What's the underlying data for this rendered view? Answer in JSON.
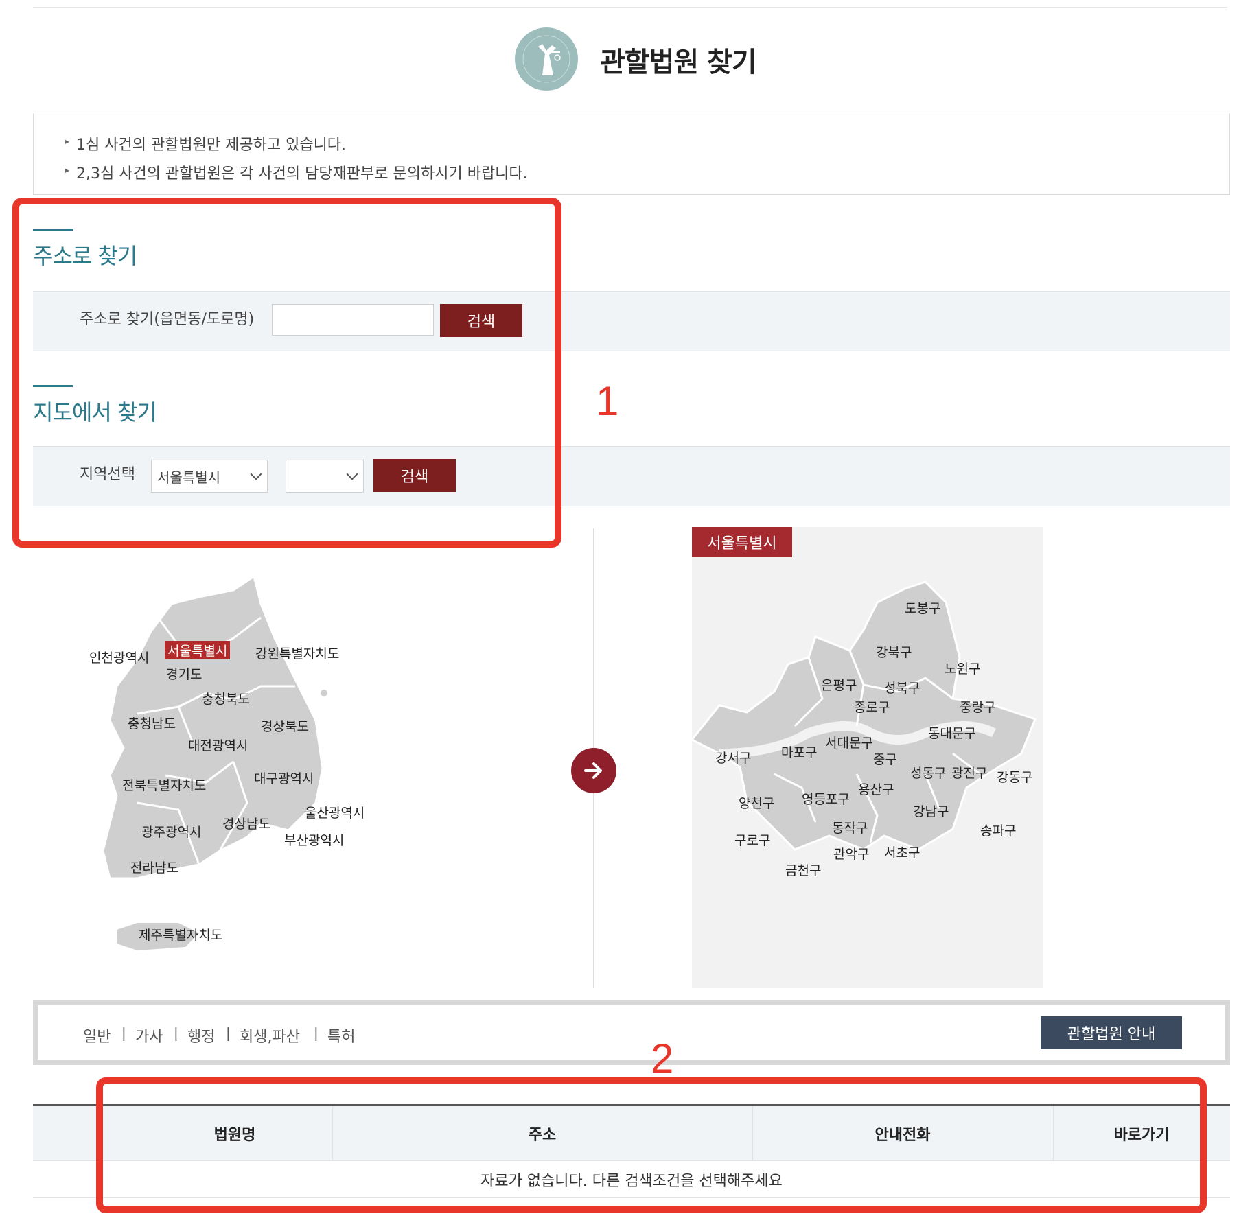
{
  "header": {
    "title": "관할법원 찾기",
    "logo_icon": "court-seal-icon"
  },
  "notices": [
    "1심 사건의 관할법원만 제공하고 있습니다.",
    "2,3심 사건의 관할법원은 각 사건의 담당재판부로 문의하시기 바랍니다."
  ],
  "address_search": {
    "section_title": "주소로 찾기",
    "label": "주소로 찾기(읍면동/도로명)",
    "input_value": "",
    "button": "검색"
  },
  "map_search": {
    "section_title": "지도에서 찾기",
    "label": "지역선택",
    "region_selected": "서울특별시",
    "district_selected": "",
    "button": "검색"
  },
  "annotations": {
    "box1": "1",
    "box2": "2"
  },
  "korea_map": {
    "labels": [
      "인천광역시",
      "서울특별시",
      "강원특별자치도",
      "경기도",
      "충청북도",
      "충청남도",
      "경상북도",
      "대전광역시",
      "전북특별자치도",
      "대구광역시",
      "울산광역시",
      "경상남도",
      "광주광역시",
      "부산광역시",
      "전라남도",
      "제주특별자치도"
    ],
    "selected": "서울특별시"
  },
  "seoul_map": {
    "tag": "서울특별시",
    "districts": [
      "도봉구",
      "강북구",
      "노원구",
      "은평구",
      "성북구",
      "종로구",
      "중랑구",
      "동대문구",
      "서대문구",
      "마포구",
      "강서구",
      "중구",
      "성동구",
      "광진구",
      "강동구",
      "용산구",
      "양천구",
      "영등포구",
      "강남구",
      "송파구",
      "동작구",
      "구로구",
      "관악구",
      "서초구",
      "금천구"
    ]
  },
  "case_tabs": [
    "일반",
    "가사",
    "행정",
    "회생,파산",
    "특허"
  ],
  "guide_button": "관할법원 안내",
  "table": {
    "headers": [
      "법원명",
      "주소",
      "안내전화",
      "바로가기"
    ],
    "empty_message": "자료가 없습니다. 다른 검색조건을 선택해주세요"
  },
  "colors": {
    "accent_teal": "#2b7a8c",
    "button_red": "#7d1f1f",
    "highlight_red": "#b22a2a",
    "annotation_red": "#e8362a",
    "navy": "#3b4a5e"
  }
}
